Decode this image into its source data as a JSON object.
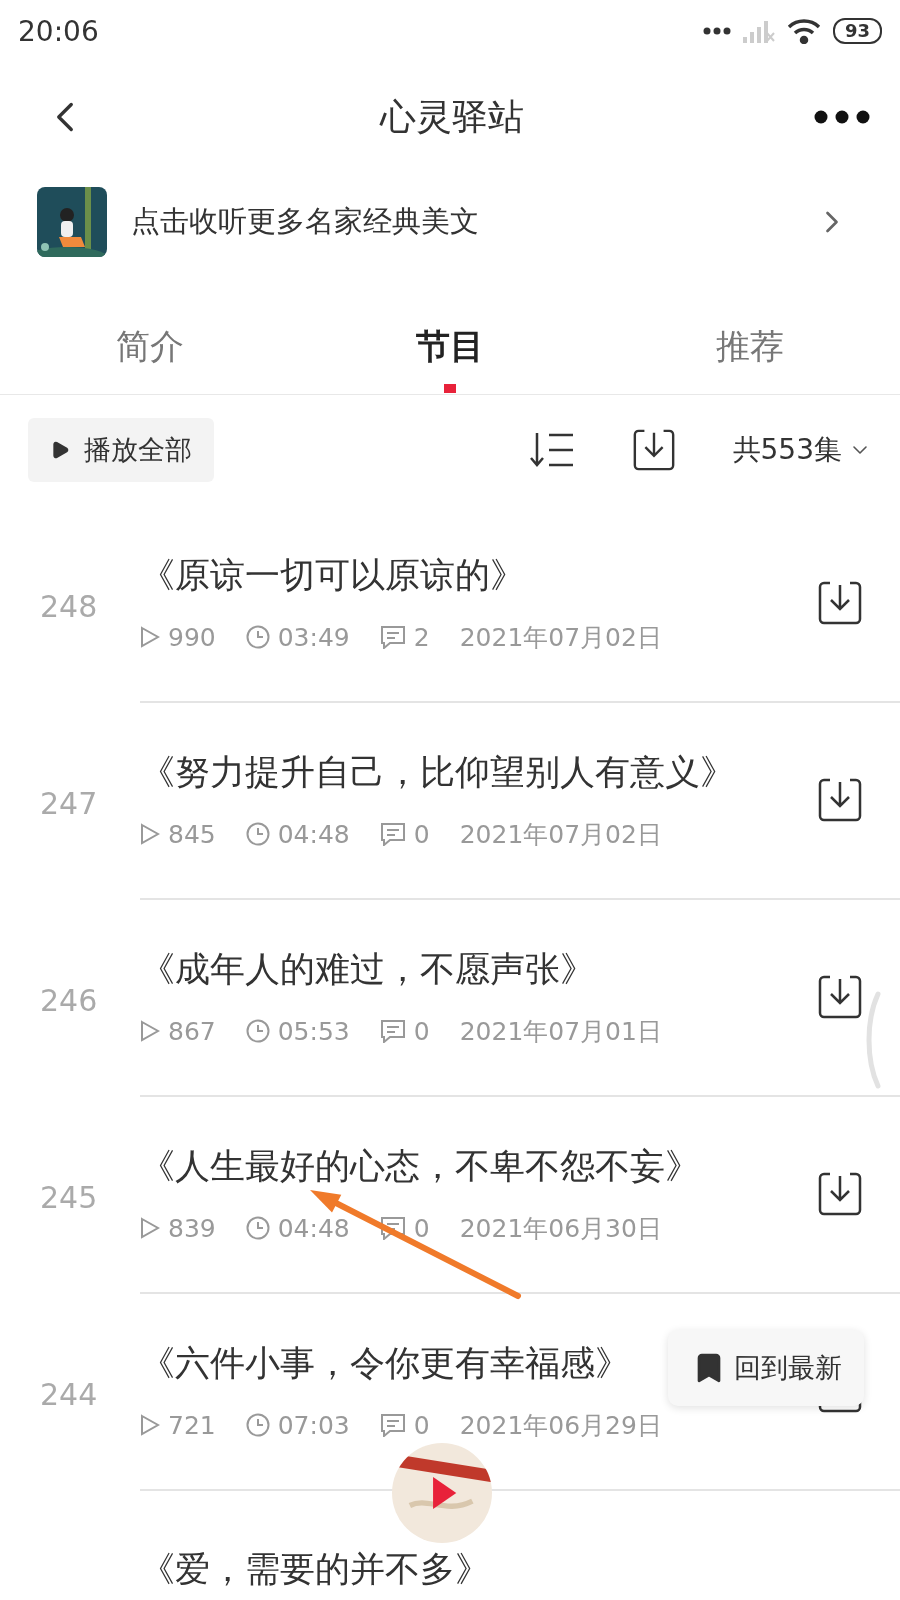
{
  "status_bar": {
    "time": "20:06",
    "battery": "93"
  },
  "header": {
    "title": "心灵驿站"
  },
  "banner": {
    "text": "点击收听更多名家经典美文"
  },
  "tabs": [
    {
      "label": "简介",
      "selected": false
    },
    {
      "label": "节目",
      "selected": true
    },
    {
      "label": "推荐",
      "selected": false
    }
  ],
  "toolbar": {
    "play_all": "播放全部",
    "count": "共553集"
  },
  "episodes": [
    {
      "number": "248",
      "title": "《原谅一切可以原谅的》",
      "plays": "990",
      "duration": "03:49",
      "comments": "2",
      "date": "2021年07月02日"
    },
    {
      "number": "247",
      "title": "《努力提升自己，比仰望别人有意义》",
      "plays": "845",
      "duration": "04:48",
      "comments": "0",
      "date": "2021年07月02日"
    },
    {
      "number": "246",
      "title": "《成年人的难过，不愿声张》",
      "plays": "867",
      "duration": "05:53",
      "comments": "0",
      "date": "2021年07月01日"
    },
    {
      "number": "245",
      "title": "《人生最好的心态，不卑不怨不妄》",
      "plays": "839",
      "duration": "04:48",
      "comments": "0",
      "date": "2021年06月30日"
    },
    {
      "number": "244",
      "title": "《六件小事，令你更有幸福感》",
      "plays": "721",
      "duration": "07:03",
      "comments": "0",
      "date": "2021年06月29日"
    }
  ],
  "partial_episode": {
    "title": "《爱，需要的并不多》"
  },
  "back_to_latest": {
    "label": "回到最新"
  }
}
